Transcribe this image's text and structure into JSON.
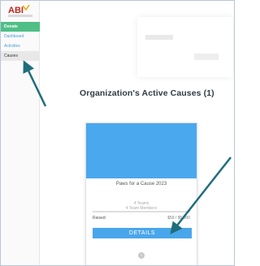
{
  "app": {
    "logo_text": "ABI"
  },
  "sidebar": {
    "items": [
      {
        "label": "Donate"
      },
      {
        "label": "Dashboard"
      },
      {
        "label": "Activities"
      },
      {
        "label": "Causes"
      }
    ]
  },
  "main": {
    "heading": "Organization's Active Causes (1)"
  },
  "cause_card": {
    "title": "Paws for a Cause 2023",
    "teams": "4 Teams",
    "members": "4 Team Members",
    "raised_label": "Raised:",
    "raised_amount": "$59 / $5,000",
    "details_label": "DETAILS"
  },
  "colors": {
    "donate_bg": "#4fbf86",
    "accent_blue": "#4aa8ee",
    "arrow": "#1f6e7c"
  },
  "icons": {
    "logo": "abi-logo",
    "annotation_arrows": "arrow-icon"
  }
}
